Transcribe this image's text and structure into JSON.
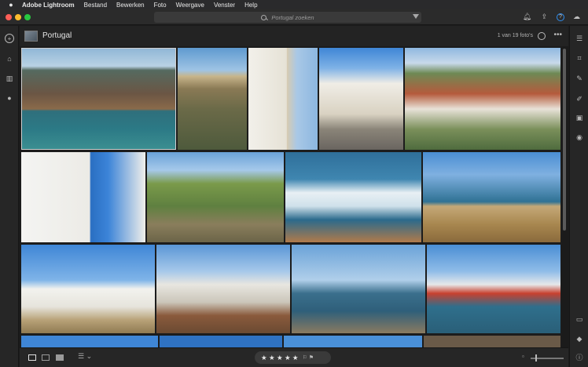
{
  "menubar": {
    "apple": "",
    "app_name": "Adobe Lightroom",
    "items": [
      "Bestand",
      "Bewerken",
      "Foto",
      "Weergave",
      "Venster",
      "Help"
    ]
  },
  "toolbar": {
    "search_placeholder": "Portugal zoeken",
    "icons": [
      "bell-icon",
      "share-icon",
      "help-icon",
      "cloud-icon"
    ]
  },
  "album": {
    "title": "Portugal",
    "count": "1 van 19 foto's"
  },
  "rating": {
    "stars": "★ ★ ★ ★ ★",
    "flags": "⚐ ⚑"
  },
  "colors": {
    "accent": "#2f8ef0",
    "background": "#1b1b1b",
    "panel": "#262626"
  },
  "photos": [
    {
      "name": "photo-cliffs-coast",
      "selected": true
    },
    {
      "name": "photo-cliff-village"
    },
    {
      "name": "photo-white-arcade"
    },
    {
      "name": "photo-street-houses"
    },
    {
      "name": "photo-hillside-town"
    },
    {
      "name": "photo-laundry-street"
    },
    {
      "name": "photo-green-valley"
    },
    {
      "name": "photo-crashing-wave"
    },
    {
      "name": "photo-cape-cliff-church"
    },
    {
      "name": "photo-lighthouse"
    },
    {
      "name": "photo-camper-van"
    },
    {
      "name": "photo-sailboats-harbor"
    },
    {
      "name": "photo-fishing-boats"
    }
  ]
}
